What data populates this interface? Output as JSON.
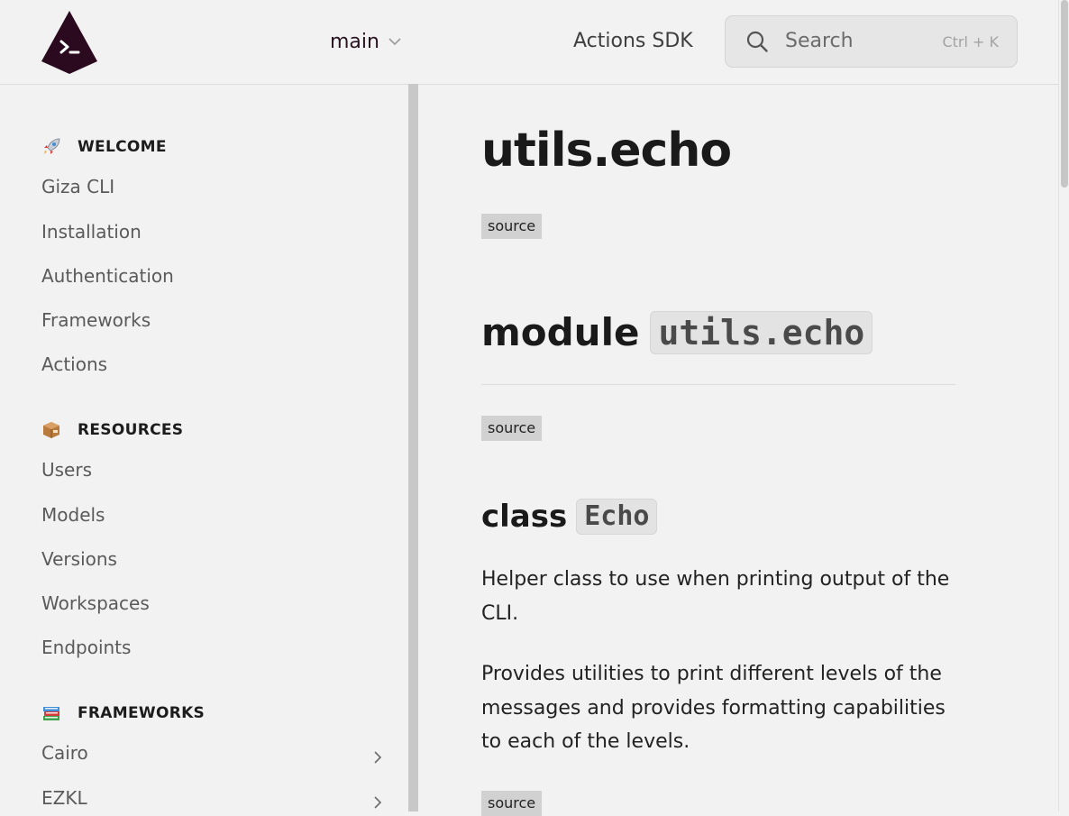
{
  "header": {
    "version": "main",
    "nav_link": "Actions SDK",
    "search_placeholder": "Search",
    "search_shortcut": "Ctrl + K"
  },
  "sidebar": {
    "sections": [
      {
        "title": "WELCOME",
        "icon": "rocket-icon",
        "items": [
          "Giza CLI",
          "Installation",
          "Authentication",
          "Frameworks",
          "Actions"
        ]
      },
      {
        "title": "RESOURCES",
        "icon": "package-icon",
        "items": [
          "Users",
          "Models",
          "Versions",
          "Workspaces",
          "Endpoints"
        ]
      },
      {
        "title": "FRAMEWORKS",
        "icon": "books-icon",
        "items": [
          "Cairo",
          "EZKL"
        ]
      }
    ]
  },
  "main": {
    "title": "utils.echo",
    "source_label": "source",
    "module_keyword": "module",
    "module_name": "utils.echo",
    "class_keyword": "class",
    "class_name": "Echo",
    "paragraphs": [
      "Helper class to use when printing output of the CLI.",
      "Provides utilities to print different levels of the messages and provides formatting capabilities to each of the levels."
    ]
  },
  "colors": {
    "brand": "#2b0a1f",
    "background": "#f2f2f2",
    "badge": "#d1d1d1"
  }
}
